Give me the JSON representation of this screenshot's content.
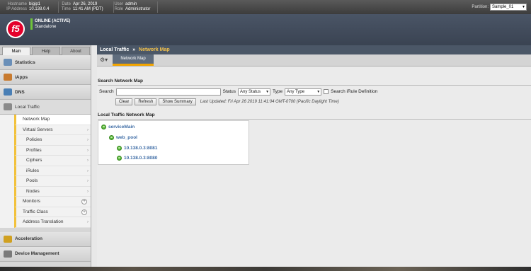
{
  "topbar": {
    "hostname_label": "Hostname",
    "hostname": "bigip1",
    "ip_label": "IP Address",
    "ip": "10.138.0.4",
    "date_label": "Date",
    "date": "Apr 26, 2019",
    "time_label": "Time",
    "time": "11:41 AM (PDT)",
    "user_label": "User",
    "user": "admin",
    "role_label": "Role",
    "role": "Administrator",
    "partition_label": "Partition:",
    "partition_value": "Sample_01"
  },
  "header": {
    "logo_text": "f5",
    "status_line1": "ONLINE (ACTIVE)",
    "status_line2": "Standalone"
  },
  "sidebar": {
    "tabs": [
      "Main",
      "Help",
      "About"
    ],
    "sections_top": [
      {
        "label": "Statistics",
        "icon": "statistics-icon",
        "color": "#6a8fb8"
      },
      {
        "label": "iApps",
        "icon": "iapps-icon",
        "color": "#c87a2e"
      },
      {
        "label": "DNS",
        "icon": "dns-icon",
        "color": "#4a7fb5"
      },
      {
        "label": "Local Traffic",
        "icon": "local-traffic-icon",
        "color": "#8a8a8a"
      }
    ],
    "local_traffic_items": [
      {
        "label": "Network Map",
        "level": 1,
        "chevron": "",
        "plus": false
      },
      {
        "label": "Virtual Servers",
        "level": 1,
        "chevron": "›",
        "plus": false
      },
      {
        "label": "Policies",
        "level": 2,
        "chevron": "›",
        "plus": false
      },
      {
        "label": "Profiles",
        "level": 2,
        "chevron": "›",
        "plus": false
      },
      {
        "label": "Ciphers",
        "level": 2,
        "chevron": "›",
        "plus": false
      },
      {
        "label": "iRules",
        "level": 2,
        "chevron": "›",
        "plus": false
      },
      {
        "label": "Pools",
        "level": 2,
        "chevron": "›",
        "plus": false
      },
      {
        "label": "Nodes",
        "level": 2,
        "chevron": "›",
        "plus": false
      },
      {
        "label": "Monitors",
        "level": 1,
        "chevron": "",
        "plus": true
      },
      {
        "label": "Traffic Class",
        "level": 1,
        "chevron": "",
        "plus": true
      },
      {
        "label": "Address Translation",
        "level": 1,
        "chevron": "›",
        "plus": false
      }
    ],
    "sections_bottom": [
      {
        "label": "Acceleration",
        "icon": "acceleration-icon",
        "color": "#d0a020"
      },
      {
        "label": "Device Management",
        "icon": "device-management-icon",
        "color": "#7a7a7a"
      }
    ]
  },
  "main": {
    "breadcrumb_root": "Local Traffic",
    "breadcrumb_sep": "»",
    "breadcrumb_current": "Network Map",
    "subtab": "Network Map",
    "search_title": "Search Network Map",
    "search_label": "Search",
    "status_label": "Status",
    "status_value": "Any Status",
    "type_label": "Type",
    "type_value": "Any Type",
    "irule_label": "Search iRule Definition",
    "clear": "Clear",
    "refresh": "Refresh",
    "show_summary": "Show Summary",
    "last_updated": "Last Updated: Fri Apr 26 2019 11:41:04 GMT-0700 (Pacific Daylight Time)",
    "map_title": "Local Traffic Network Map",
    "map_nodes": [
      "serviceMain",
      "web_pool",
      "10.138.0.3:8081",
      "10.138.0.3:8080"
    ]
  }
}
